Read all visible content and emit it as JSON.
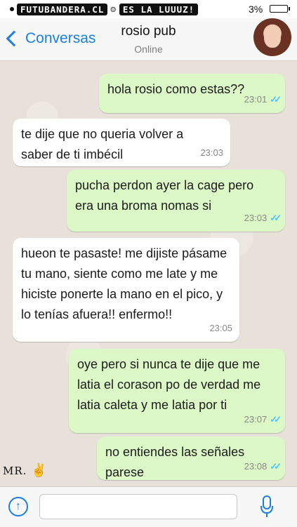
{
  "status_bar": {
    "brand_part1": "FUTUBANDERA.CL",
    "brand_part2": "ES LA LUUUZ!",
    "battery_percent": "3%"
  },
  "header": {
    "back_label": "Conversas",
    "contact_name": "rosio pub",
    "contact_status": "Online"
  },
  "messages": [
    {
      "direction": "out",
      "text": "hola rosio como estas??",
      "time": "23:01",
      "read": true
    },
    {
      "direction": "in",
      "text": "te dije que no queria volver a saber de ti imbécil",
      "time": "23:03"
    },
    {
      "direction": "out",
      "text": "pucha perdon ayer la cage pero era una broma nomas si",
      "time": "23:03",
      "read": true
    },
    {
      "direction": "in",
      "text": "hueon te pasaste! me dijiste pásame tu mano, siente como me late y me hiciste ponerte la mano en el pico, y lo tenías afuera!! enfermo!!",
      "time": "23:05"
    },
    {
      "direction": "out",
      "text": "oye pero si nunca te dije que me latia el corason po de verdad me latia caleta y me latia por ti",
      "time": "23:07",
      "read": true
    },
    {
      "direction": "out",
      "text": "no entiendes las señales parese",
      "time": "23:08",
      "read": true
    }
  ],
  "watermark": {
    "signature": "MR."
  },
  "input_bar": {
    "message_placeholder": "",
    "upload_icon": "upload-arrow-icon",
    "mic_icon": "microphone-icon"
  },
  "colors": {
    "accent": "#1a7fe6",
    "outgoing_bubble": "#dcf8c6",
    "incoming_bubble": "#ffffff",
    "read_ticks": "#4fc3f7"
  }
}
